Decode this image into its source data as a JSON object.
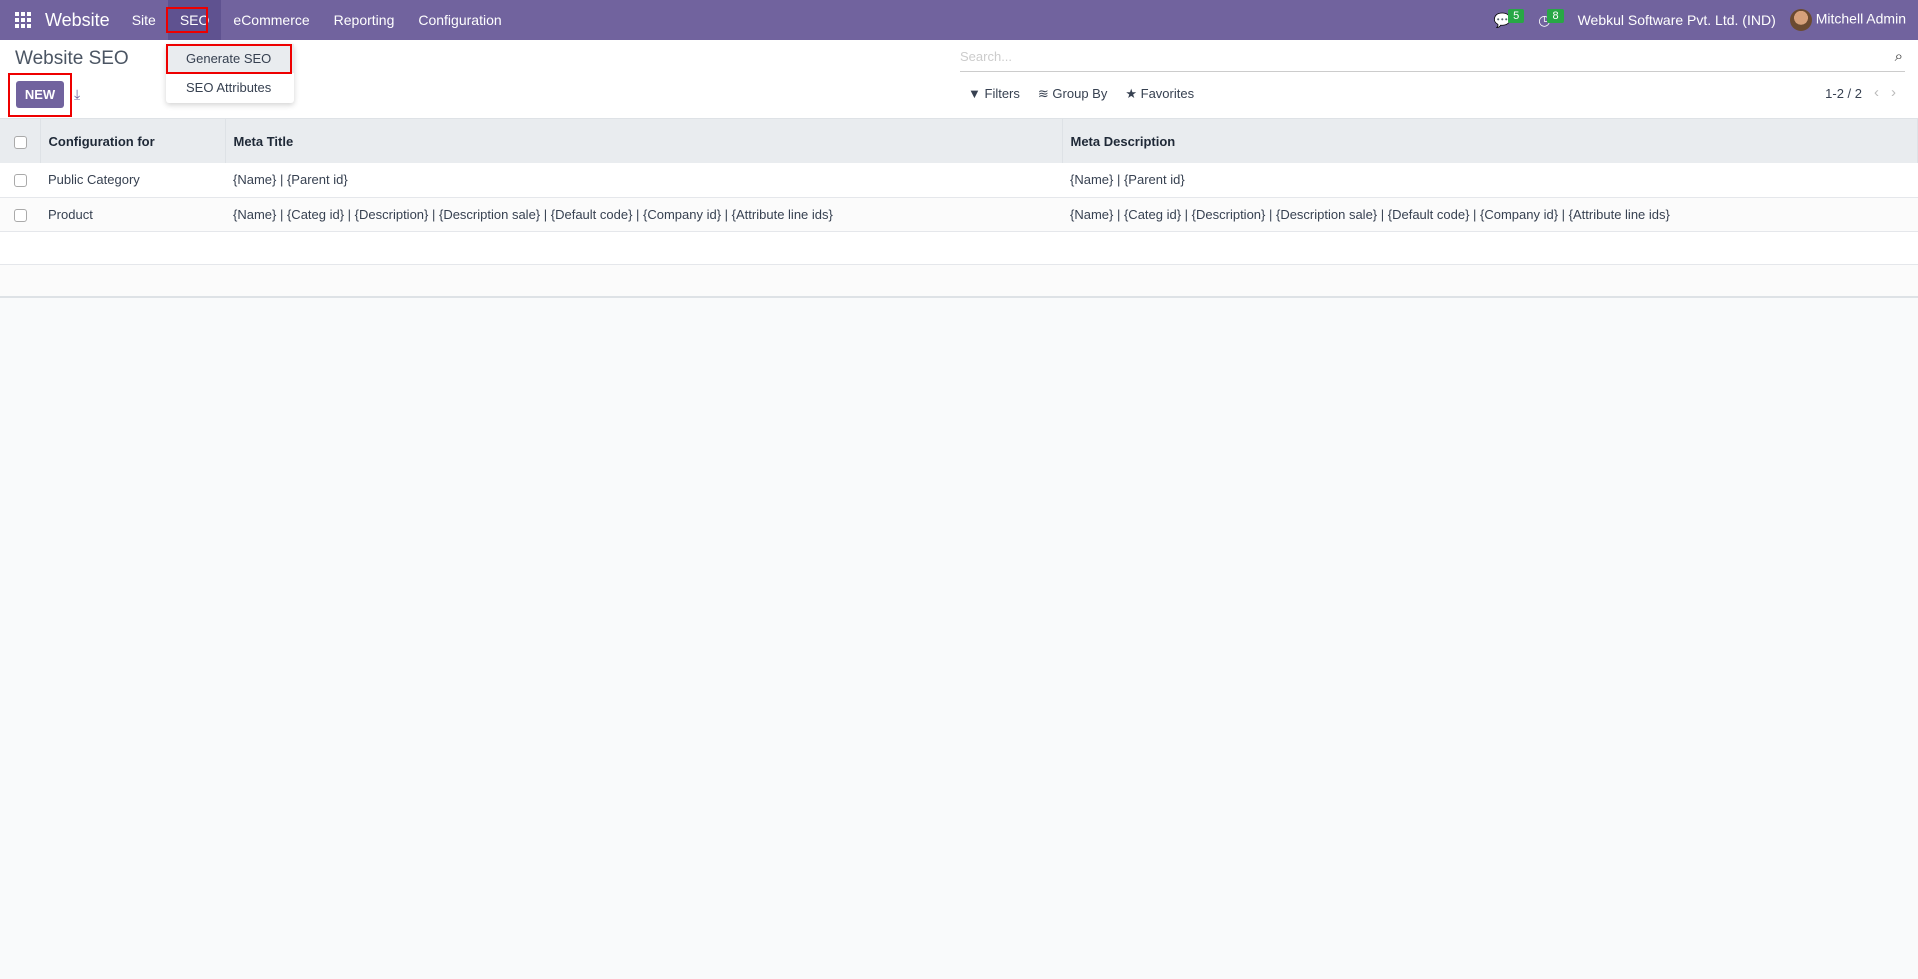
{
  "navbar": {
    "app": "Website",
    "menus": [
      "Site",
      "SEO",
      "eCommerce",
      "Reporting",
      "Configuration"
    ],
    "messages_count": "5",
    "activities_count": "8",
    "company": "Webkul Software Pvt. Ltd. (IND)",
    "user": "Mitchell Admin",
    "color": "#71639e"
  },
  "seo_dropdown": {
    "items": [
      "Generate SEO",
      "SEO Attributes"
    ]
  },
  "page": {
    "title": "Website SEO",
    "new_label": "NEW"
  },
  "search": {
    "placeholder": "Search..."
  },
  "filters": {
    "filters": "Filters",
    "group_by": "Group By",
    "favorites": "Favorites"
  },
  "pager": {
    "text": "1-2 / 2"
  },
  "table": {
    "headers": [
      "Configuration for",
      "Meta Title",
      "Meta Description"
    ],
    "rows": [
      {
        "config": "Public Category",
        "title": "{Name} | {Parent id}",
        "description": "{Name} | {Parent id}"
      },
      {
        "config": "Product",
        "title": "{Name} | {Categ id} | {Description} | {Description sale} | {Default code} | {Company id} | {Attribute line ids}",
        "description": "{Name} | {Categ id} | {Description} | {Description sale} | {Default code} | {Company id} | {Attribute line ids}"
      }
    ]
  }
}
